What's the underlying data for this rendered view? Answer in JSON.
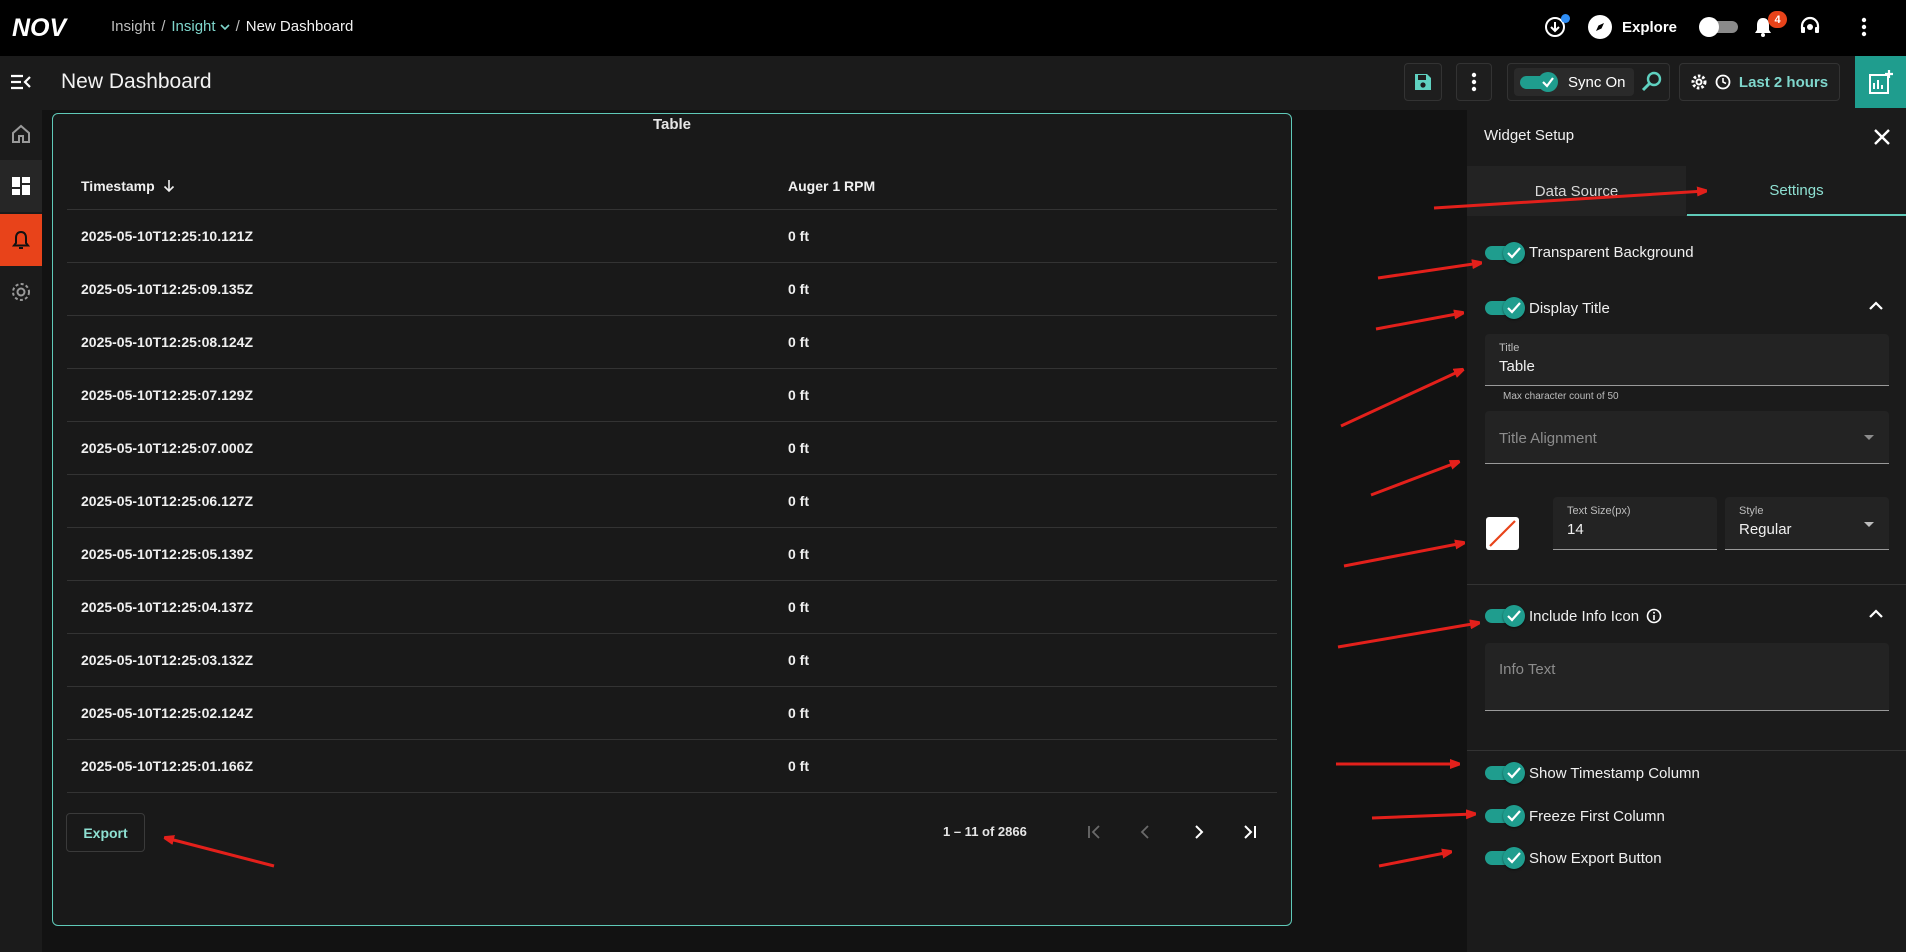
{
  "topbar": {
    "brand": "NOV",
    "breadcrumb": {
      "root": "Insight",
      "section": "Insight",
      "current": "New Dashboard"
    },
    "explore_label": "Explore",
    "notification_count": "4"
  },
  "header": {
    "title": "New Dashboard",
    "sync_label": "Sync On",
    "time_range": "Last 2 hours"
  },
  "widget": {
    "title": "Table",
    "columns": [
      "Timestamp",
      "Auger 1 RPM"
    ],
    "rows": [
      [
        "2025-05-10T12:25:10.121Z",
        "0 ft"
      ],
      [
        "2025-05-10T12:25:09.135Z",
        "0 ft"
      ],
      [
        "2025-05-10T12:25:08.124Z",
        "0 ft"
      ],
      [
        "2025-05-10T12:25:07.129Z",
        "0 ft"
      ],
      [
        "2025-05-10T12:25:07.000Z",
        "0 ft"
      ],
      [
        "2025-05-10T12:25:06.127Z",
        "0 ft"
      ],
      [
        "2025-05-10T12:25:05.139Z",
        "0 ft"
      ],
      [
        "2025-05-10T12:25:04.137Z",
        "0 ft"
      ],
      [
        "2025-05-10T12:25:03.132Z",
        "0 ft"
      ],
      [
        "2025-05-10T12:25:02.124Z",
        "0 ft"
      ],
      [
        "2025-05-10T12:25:01.166Z",
        "0 ft"
      ]
    ],
    "export_label": "Export",
    "pagination": "1 – 11 of 2866"
  },
  "panel": {
    "title": "Widget Setup",
    "tabs": [
      "Data Source",
      "Settings"
    ],
    "active_tab": "Settings",
    "toggles": {
      "transparent_background": "Transparent Background",
      "display_title": "Display Title",
      "include_info_icon": "Include Info Icon",
      "show_timestamp_column": "Show Timestamp Column",
      "freeze_first_column": "Freeze First Column",
      "show_export_button": "Show Export Button"
    },
    "title_field": {
      "label": "Title",
      "value": "Table",
      "hint": "Max character count of 50"
    },
    "title_alignment_placeholder": "Title Alignment",
    "text_size": {
      "label": "Text Size(px)",
      "value": "14"
    },
    "style": {
      "label": "Style",
      "value": "Regular"
    },
    "info_text_placeholder": "Info Text"
  },
  "colors": {
    "accent": "#1f9d8e",
    "accent_text": "#8ee0d2",
    "alert": "#e8431a",
    "annotation_arrow": "#e3201b"
  }
}
